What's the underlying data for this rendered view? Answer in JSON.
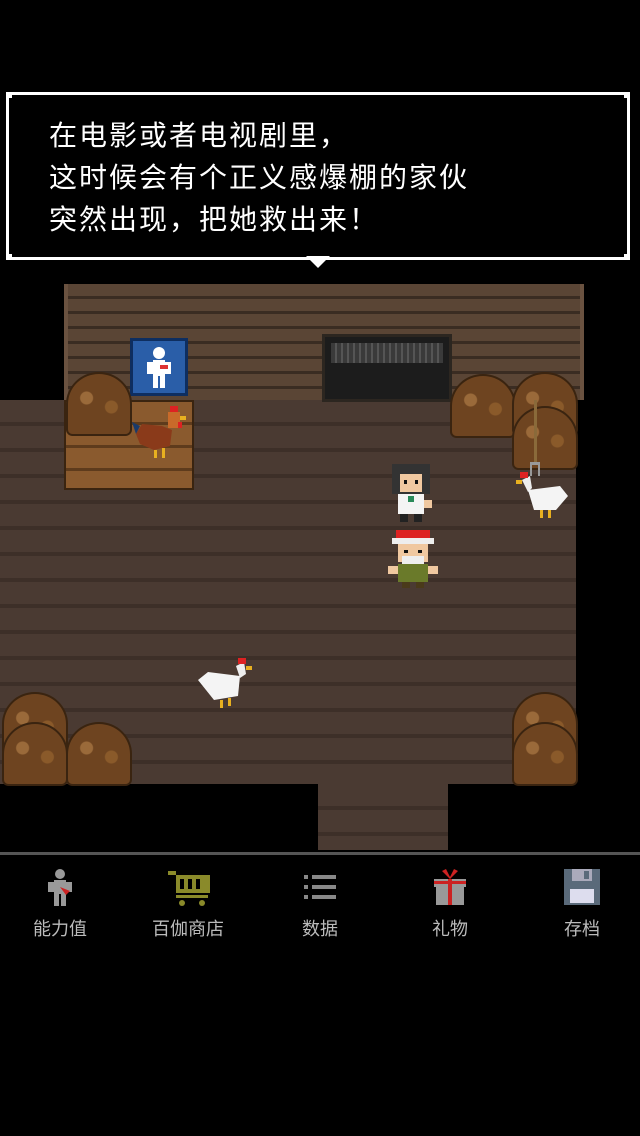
{
  "dialog": {
    "text": "在电影或者电视剧里，\n这时候会有个正义感爆棚的家伙\n突然出现，把她救出来！"
  },
  "menu": {
    "items": [
      {
        "label": "能力值",
        "icon": "status-figure-icon"
      },
      {
        "label": "百伽商店",
        "icon": "shopping-cart-icon"
      },
      {
        "label": "数据",
        "icon": "list-icon"
      },
      {
        "label": "礼物",
        "icon": "gift-icon"
      },
      {
        "label": "存档",
        "icon": "floppy-disk-icon"
      }
    ]
  },
  "colors": {
    "dialog_border": "#ffffff",
    "floor": "#4a3a32",
    "wall": "#5a4535",
    "menu_label": "#bbbbbb",
    "sign": "#2a5ea8"
  }
}
